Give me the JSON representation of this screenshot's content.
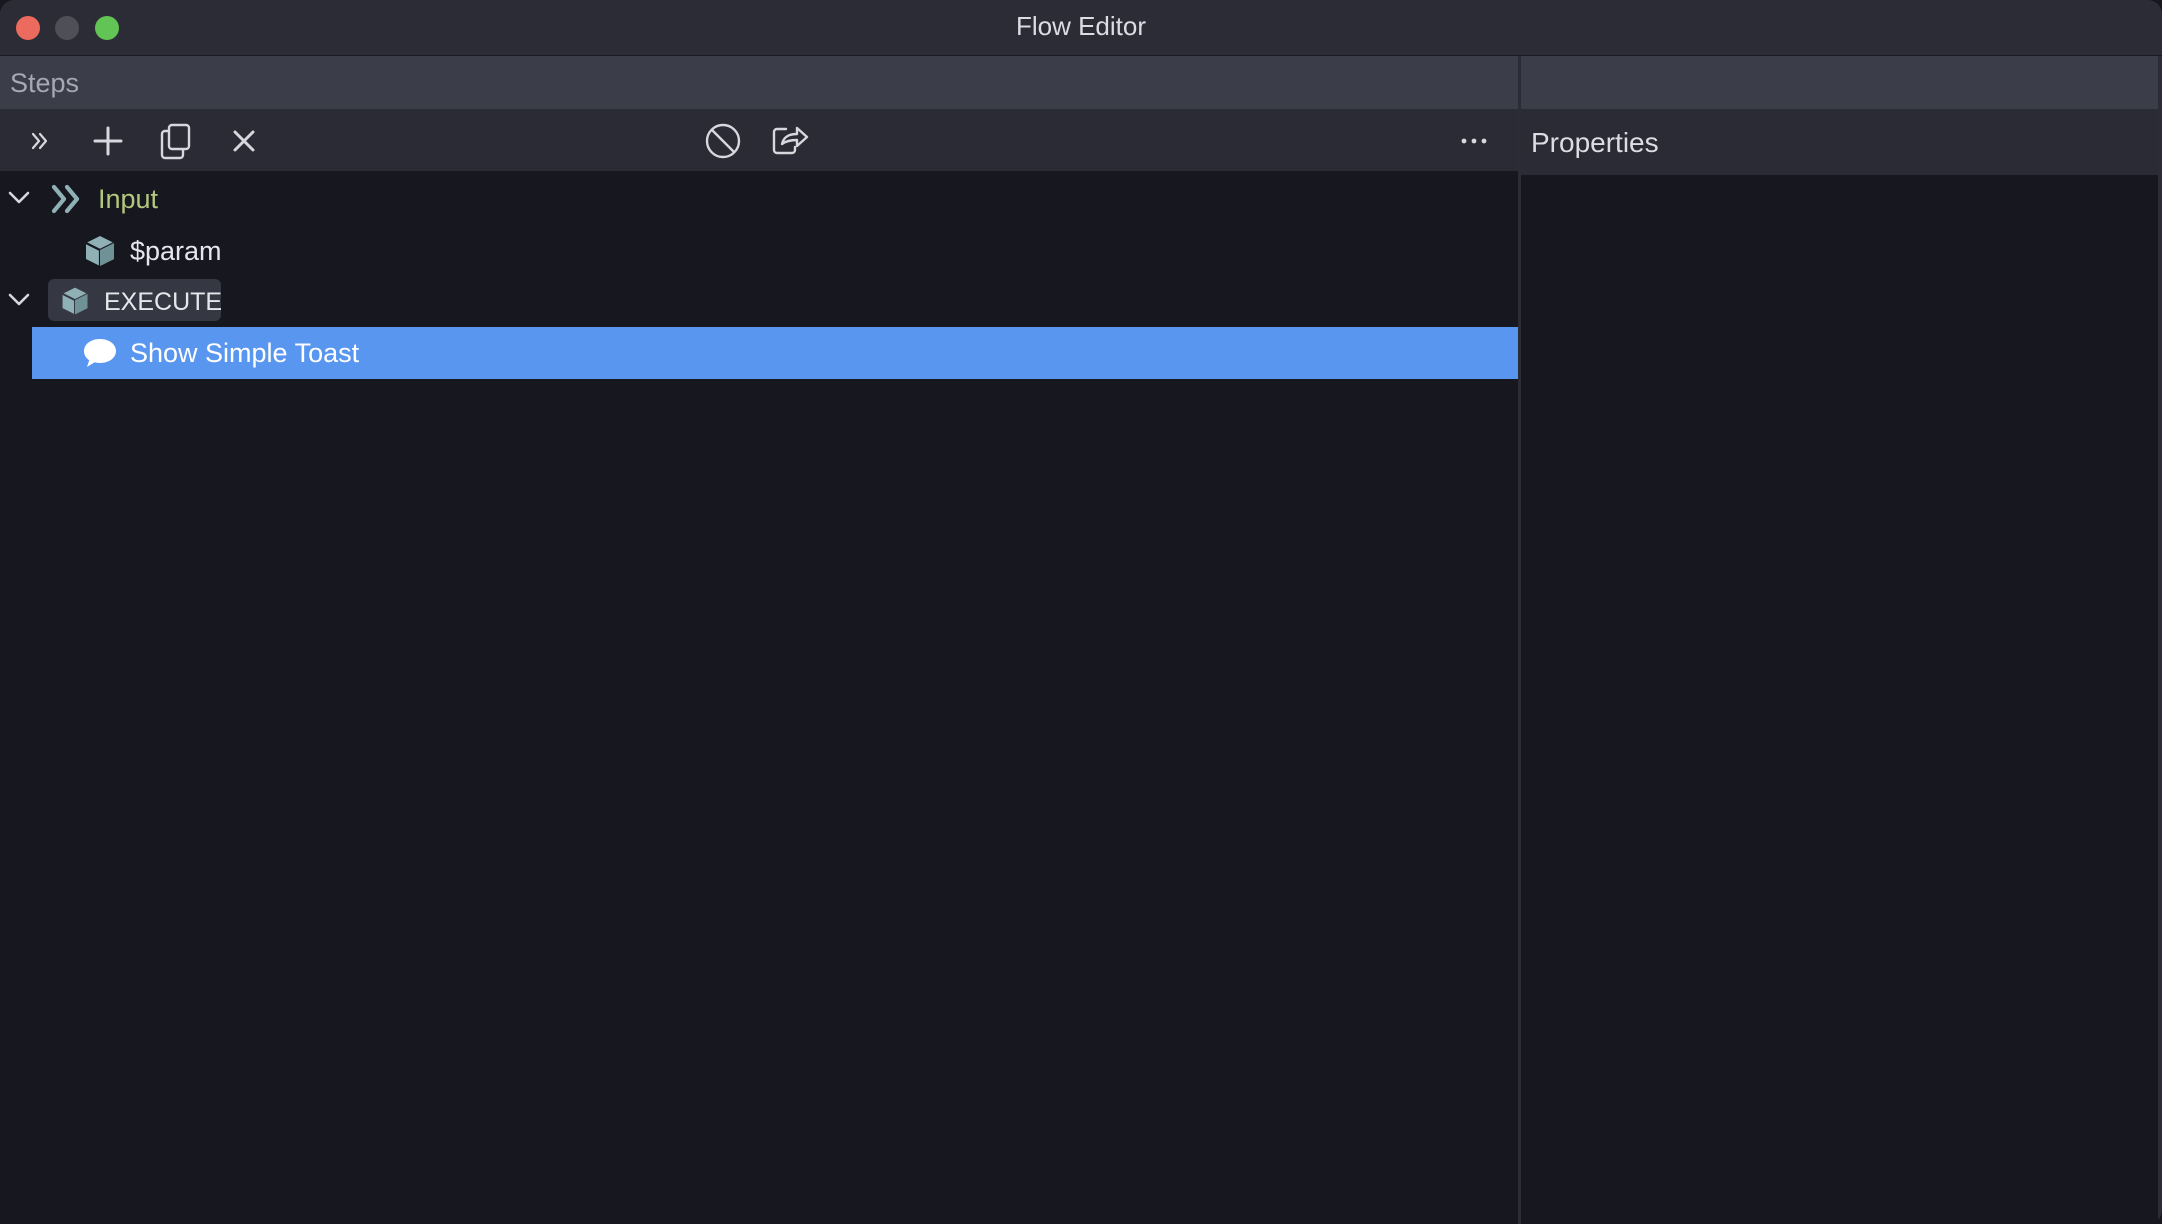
{
  "window": {
    "title": "Flow Editor"
  },
  "steps_panel": {
    "title": "Steps",
    "toolbar": [
      {
        "icon": "double-chevron-right-icon",
        "action": "expand"
      },
      {
        "icon": "plus-icon",
        "action": "add"
      },
      {
        "icon": "copy-icon",
        "action": "duplicate"
      },
      {
        "icon": "x-icon",
        "action": "delete"
      },
      {
        "icon": "disable-icon",
        "action": "disable"
      },
      {
        "icon": "export-icon",
        "action": "export"
      },
      {
        "icon": "ellipsis-icon",
        "action": "more"
      }
    ],
    "tree": [
      {
        "label": "Input",
        "icon": "double-chevron-right-icon",
        "expanded": true,
        "children": [
          {
            "label": "$param",
            "icon": "cube-icon"
          }
        ]
      },
      {
        "label": "EXECUTE",
        "icon": "cube-icon",
        "expanded": true,
        "children": [
          {
            "label": "Show Simple Toast",
            "icon": "speech-bubble-icon",
            "selected": true
          }
        ]
      }
    ]
  },
  "properties_panel": {
    "title": "Properties"
  },
  "colors": {
    "accent_selection": "#5896f0",
    "input_label": "#b5c77c",
    "icon_teal": "#8fb1b5"
  }
}
